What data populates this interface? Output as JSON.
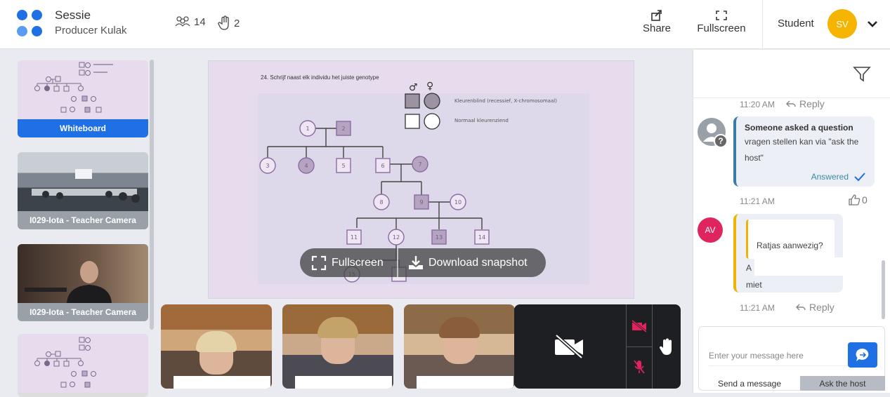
{
  "header": {
    "title": "Sessie",
    "subtitle": "Producer Kulak",
    "participant_count": "14",
    "raised_hands": "2",
    "share_label": "Share",
    "fullscreen_label": "Fullscreen",
    "role": "Student",
    "avatar_initials": "SV"
  },
  "sidebar": {
    "items": [
      {
        "label": "Whiteboard"
      },
      {
        "label": "I029-Iota - Teacher Camera"
      },
      {
        "label": "I029-Iota - Teacher Camera"
      }
    ]
  },
  "main": {
    "slide_title": "24. Schrijf naast elk individu het juiste genotype",
    "legend_1": "Kleurenblind  (recessief, X-chromosomaal)",
    "legend_2": "Normaal kleurenziend",
    "nodes": [
      "1",
      "2",
      "3",
      "4",
      "5",
      "6",
      "7",
      "8",
      "9",
      "10",
      "11",
      "12",
      "13",
      "14",
      "15"
    ],
    "overlay_fullscreen": "Fullscreen",
    "overlay_download": "Download snapshot"
  },
  "chat": {
    "time_1": "11:20 AM",
    "reply_label": "Reply",
    "question_title": "Someone asked a question",
    "question_text": "vragen stellen kan via \"ask the host\"",
    "answered_label": "Answered",
    "time_2": "11:21 AM",
    "like_count": "0",
    "msg_avatar": "AV",
    "quoted_text": "Ratjas aanwezig?",
    "msg_prefix": "A",
    "msg_text": "miet",
    "time_3": "11:21 AM",
    "input_placeholder": "Enter your message here",
    "tab_send": "Send a message",
    "tab_ask": "Ask the host"
  },
  "colors": {
    "brand_blue": "#1f6fe5",
    "avatar_yellow": "#f5b400",
    "avatar_pink": "#e0245e",
    "slide_lilac": "#e7dcee"
  }
}
